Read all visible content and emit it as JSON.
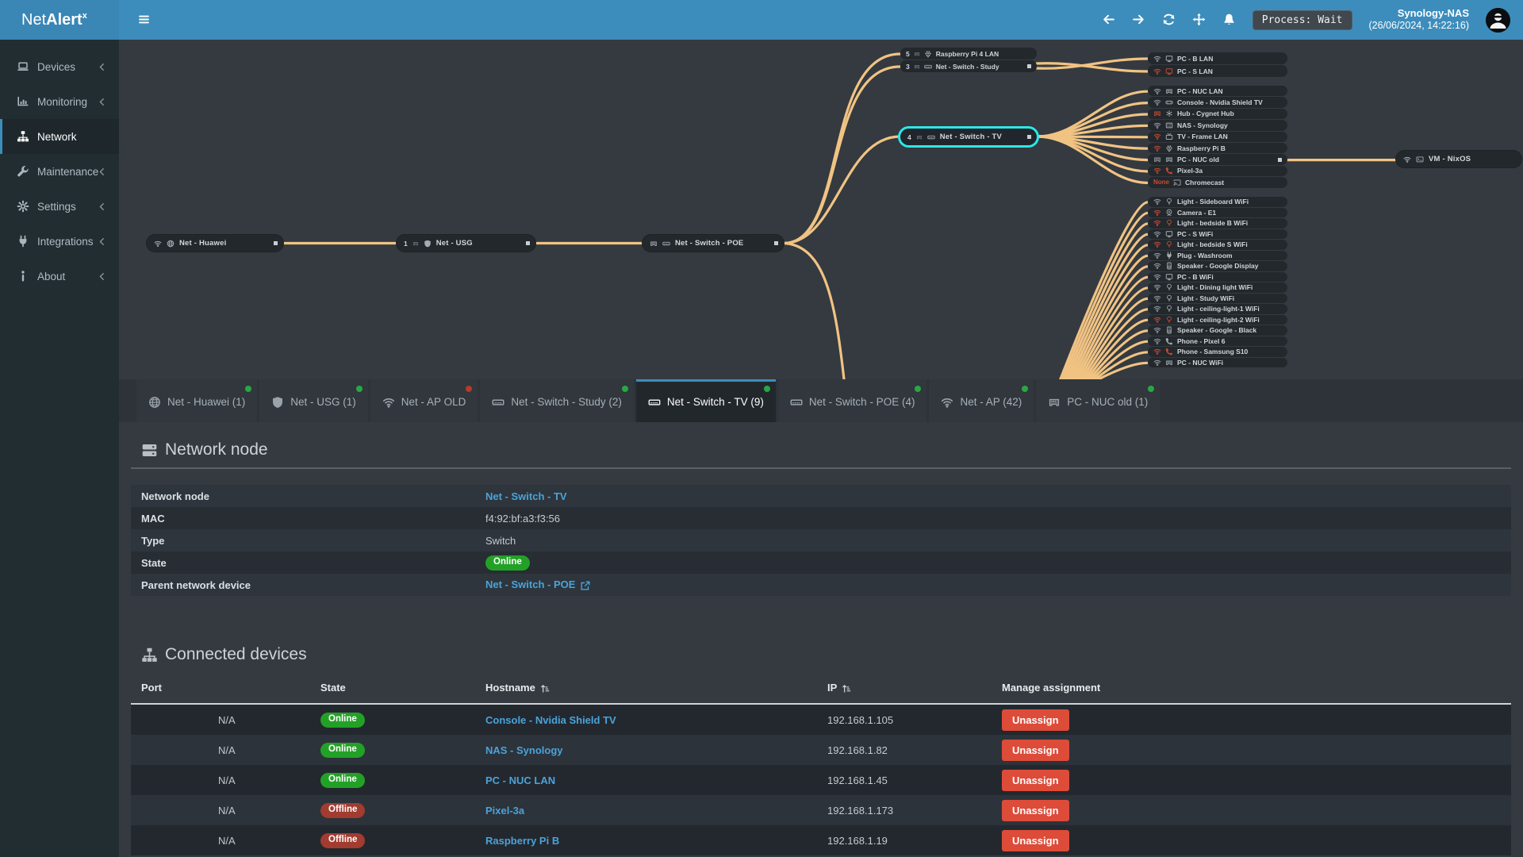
{
  "colors": {
    "accent": "#3c8dbc",
    "edge": "#f1c383",
    "selected_node": "#2ee6e6",
    "online": "#23a127",
    "offline": "#a23b30",
    "danger": "#dd4b39",
    "link": "#4aa3db",
    "dot_green": "#28a745",
    "dot_red": "#b33a2d"
  },
  "header": {
    "brand": {
      "light": "Net",
      "bold": "Alert",
      "sup": "x"
    },
    "nav_icons": [
      "arrow-left",
      "arrow-right",
      "refresh",
      "move",
      "bell"
    ],
    "process_label": "Process: Wait",
    "host": "Synology-NAS",
    "time": "(26/06/2024, 14:22:16)"
  },
  "sidebar": {
    "items": [
      {
        "icon": "laptop",
        "label": "Devices",
        "chevron": true
      },
      {
        "icon": "chart",
        "label": "Monitoring",
        "chevron": true
      },
      {
        "icon": "sitemap",
        "label": "Network",
        "active": true
      },
      {
        "icon": "wrench",
        "label": "Maintenance",
        "chevron": true
      },
      {
        "icon": "gear",
        "label": "Settings",
        "chevron": true
      },
      {
        "icon": "plug",
        "label": "Integrations",
        "chevron": true
      },
      {
        "icon": "info",
        "label": "About",
        "chevron": true
      }
    ]
  },
  "topology": {
    "nodes": [
      {
        "id": "huawei",
        "icons": [
          "wifi",
          "globe"
        ],
        "label": "Net - Huawei",
        "handle": true
      },
      {
        "id": "usg",
        "port": "1",
        "icons": [
          "shield"
        ],
        "label": "Net - USG",
        "handle": true
      },
      {
        "id": "poe",
        "icons": [
          "eth",
          "switch"
        ],
        "label": "Net - Switch - POE",
        "handle": true
      },
      {
        "id": "tv",
        "port": "4",
        "icons": [
          "switch"
        ],
        "label": "Net - Switch - TV",
        "handle": true,
        "selected": true
      },
      {
        "id": "vm",
        "icons": [
          "wifi",
          "vm"
        ],
        "label": "VM - NixOS"
      }
    ],
    "clusters": [
      {
        "id": "top",
        "rows": [
          {
            "port": "5",
            "icon": "raspi",
            "label": "Raspberry Pi 4 LAN"
          },
          {
            "port": "3",
            "icon": "switch",
            "label": "Net - Switch - Study",
            "handle": true
          }
        ]
      },
      {
        "id": "righttop",
        "rows": [
          {
            "conn": "wifi",
            "icon": "monitor",
            "label": "PC - B LAN"
          },
          {
            "conn": "wifi",
            "conn_bad": true,
            "icon": "monitor",
            "icon_bad": true,
            "label": "PC - S LAN"
          }
        ]
      },
      {
        "id": "mid",
        "rows": [
          {
            "conn": "wifi",
            "icon": "eth",
            "label": "PC - NUC LAN"
          },
          {
            "conn": "wifi",
            "icon": "console",
            "label": "Console - Nvidia Shield TV"
          },
          {
            "conn": "eth",
            "conn_bad": true,
            "icon": "hub",
            "label": "Hub - Cygnet Hub"
          },
          {
            "conn": "wifi",
            "icon": "nas",
            "label": "NAS - Synology"
          },
          {
            "conn": "wifi",
            "conn_bad": true,
            "icon": "tv",
            "label": "TV - Frame LAN"
          },
          {
            "conn": "wifi",
            "conn_bad": true,
            "icon": "raspi",
            "label": "Raspberry Pi B"
          },
          {
            "conn": "eth",
            "icon": "eth",
            "label": "PC - NUC old",
            "handle": true
          },
          {
            "conn": "wifi",
            "conn_bad": true,
            "icon": "phone",
            "icon_bad": true,
            "label": "Pixel-3a"
          },
          {
            "none": "None",
            "icon": "cast",
            "label": "Chromecast"
          }
        ]
      },
      {
        "id": "low",
        "rows": [
          {
            "conn": "wifi",
            "icon": "bulb",
            "label": "Light - Sideboard WiFi"
          },
          {
            "conn": "wifi",
            "conn_bad": true,
            "icon": "camera",
            "label": "Camera - E1"
          },
          {
            "conn": "wifi",
            "conn_bad": true,
            "icon": "bulb",
            "icon_bad": true,
            "label": "Light - bedside B WiFi"
          },
          {
            "conn": "wifi",
            "icon": "monitor",
            "label": "PC - S WiFi"
          },
          {
            "conn": "wifi",
            "conn_bad": true,
            "icon": "bulb",
            "icon_bad": true,
            "label": "Light - bedside S WiFi"
          },
          {
            "conn": "wifi",
            "icon": "plug",
            "label": "Plug - Washroom"
          },
          {
            "conn": "wifi",
            "icon": "speaker",
            "label": "Speaker - Google Display"
          },
          {
            "conn": "wifi",
            "icon": "monitor",
            "label": "PC - B WiFi"
          },
          {
            "conn": "wifi",
            "icon": "bulb",
            "label": "Light - Dining light WiFi"
          },
          {
            "conn": "wifi",
            "icon": "bulb",
            "label": "Light - Study WiFi"
          },
          {
            "conn": "wifi",
            "icon": "bulb",
            "label": "Light - ceiling-light-1 WiFi"
          },
          {
            "conn": "wifi",
            "conn_bad": true,
            "icon": "bulb",
            "icon_bad": true,
            "label": "Light - ceiling-light-2 WiFi"
          },
          {
            "conn": "wifi",
            "icon": "speaker",
            "label": "Speaker - Google - Black"
          },
          {
            "conn": "wifi",
            "icon": "phone",
            "label": "Phone - Pixel 6"
          },
          {
            "conn": "wifi",
            "conn_bad": true,
            "icon": "phone",
            "icon_bad": true,
            "label": "Phone - Samsung S10"
          },
          {
            "conn": "wifi",
            "icon": "eth",
            "label": "PC - NUC WiFi"
          }
        ]
      }
    ]
  },
  "tabs": [
    {
      "icon": "globe",
      "label": "Net - Huawei (1)",
      "dot": "green"
    },
    {
      "icon": "shield",
      "label": "Net - USG (1)",
      "dot": "green"
    },
    {
      "icon": "wifi",
      "label": "Net - AP OLD",
      "dot": "red"
    },
    {
      "icon": "switch",
      "label": "Net - Switch - Study (2)",
      "dot": "green"
    },
    {
      "icon": "switch",
      "label": "Net - Switch - TV (9)",
      "dot": "green",
      "active": true
    },
    {
      "icon": "switch",
      "label": "Net - Switch - POE (4)",
      "dot": "green"
    },
    {
      "icon": "wifi",
      "label": "Net - AP (42)",
      "dot": "green"
    },
    {
      "icon": "eth",
      "label": "PC - NUC old (1)",
      "dot": "green"
    }
  ],
  "network_node": {
    "title": "Network node",
    "rows": [
      {
        "label": "Network node",
        "type": "link",
        "value": "Net - Switch - TV"
      },
      {
        "label": "MAC",
        "type": "text",
        "value": "f4:92:bf:a3:f3:56"
      },
      {
        "label": "Type",
        "type": "text",
        "value": "Switch"
      },
      {
        "label": "State",
        "type": "badge",
        "value": "Online",
        "badge": "online"
      },
      {
        "label": "Parent network device",
        "type": "link_ext",
        "value": "Net - Switch - POE"
      }
    ]
  },
  "connected_devices": {
    "title": "Connected devices",
    "columns": [
      {
        "label": "Port"
      },
      {
        "label": "State"
      },
      {
        "label": "Hostname",
        "sort": true
      },
      {
        "label": "IP",
        "sort": true
      },
      {
        "label": "Manage assignment"
      }
    ],
    "rows": [
      {
        "port": "N/A",
        "state": "Online",
        "state_kind": "online",
        "hostname": "Console - Nvidia Shield TV",
        "ip": "192.168.1.105",
        "action": "Unassign"
      },
      {
        "port": "N/A",
        "state": "Online",
        "state_kind": "online",
        "hostname": "NAS - Synology",
        "ip": "192.168.1.82",
        "action": "Unassign"
      },
      {
        "port": "N/A",
        "state": "Online",
        "state_kind": "online",
        "hostname": "PC - NUC LAN",
        "ip": "192.168.1.45",
        "action": "Unassign"
      },
      {
        "port": "N/A",
        "state": "Offline",
        "state_kind": "offline",
        "hostname": "Pixel-3a",
        "ip": "192.168.1.173",
        "action": "Unassign"
      },
      {
        "port": "N/A",
        "state": "Offline",
        "state_kind": "offline",
        "hostname": "Raspberry Pi B",
        "ip": "192.168.1.19",
        "action": "Unassign"
      }
    ]
  }
}
